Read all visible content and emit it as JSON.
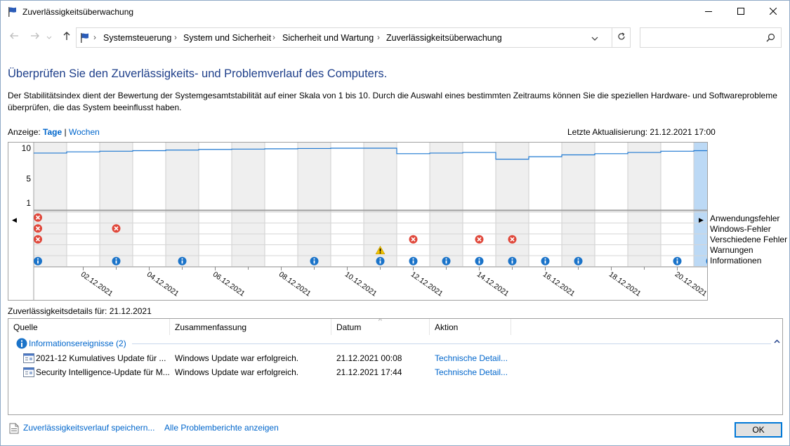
{
  "window": {
    "title": "Zuverlässigkeitsüberwachung"
  },
  "nav": {
    "breadcrumbs": [
      "Systemsteuerung",
      "System und Sicherheit",
      "Sicherheit und Wartung",
      "Zuverlässigkeitsüberwachung"
    ],
    "search_placeholder": ""
  },
  "main": {
    "heading": "Überprüfen Sie den Zuverlässigkeits- und Problemverlauf des Computers.",
    "description": "Der Stabilitätsindex dient der Bewertung der Systemgesamtstabilität auf einer Skala von 1 bis 10. Durch die Auswahl eines bestimmten Zeitraums können Sie die speziellen Hardware- und Softwareprobleme überprüfen, die das System beeinflusst haben.",
    "view_label": "Anzeige:",
    "view_days": "Tage",
    "view_sep": "|",
    "view_weeks": "Wochen",
    "last_update": "Letzte Aktualisierung: 21.12.2021 17:00"
  },
  "chart_data": {
    "type": "line",
    "title": "",
    "ylabel": "",
    "ylim": [
      1,
      10
    ],
    "yticks": [
      10,
      5,
      1
    ],
    "x": [
      "01.12.2021",
      "02.12.2021",
      "03.12.2021",
      "04.12.2021",
      "05.12.2021",
      "06.12.2021",
      "07.12.2021",
      "08.12.2021",
      "09.12.2021",
      "10.12.2021",
      "11.12.2021",
      "12.12.2021",
      "13.12.2021",
      "14.12.2021",
      "15.12.2021",
      "16.12.2021",
      "17.12.2021",
      "18.12.2021",
      "19.12.2021",
      "20.12.2021",
      "21.12.2021"
    ],
    "x_tick_labels": [
      "02.12.2021",
      "04.12.2021",
      "06.12.2021",
      "08.12.2021",
      "10.12.2021",
      "12.12.2021",
      "14.12.2021",
      "16.12.2021",
      "18.12.2021",
      "20.12.2021"
    ],
    "stability_index": [
      9.2,
      9.4,
      9.5,
      9.6,
      9.7,
      9.8,
      9.85,
      9.9,
      9.95,
      10.0,
      10.0,
      9.1,
      9.2,
      9.3,
      8.2,
      8.6,
      8.9,
      9.1,
      9.3,
      9.5,
      9.6
    ],
    "selected_date": "21.12.2021",
    "rows": [
      "Anwendungsfehler",
      "Windows-Fehler",
      "Verschiedene Fehler",
      "Warnungen",
      "Informationen"
    ],
    "events": {
      "Anwendungsfehler": [
        "01.12.2021"
      ],
      "Windows-Fehler": [
        "01.12.2021",
        "03.12.2021"
      ],
      "Verschiedene Fehler": [
        "01.12.2021",
        "12.12.2021",
        "14.12.2021",
        "15.12.2021"
      ],
      "Warnungen": [
        "11.12.2021"
      ],
      "Informationen": [
        "01.12.2021",
        "03.12.2021",
        "05.12.2021",
        "09.12.2021",
        "11.12.2021",
        "12.12.2021",
        "13.12.2021",
        "14.12.2021",
        "15.12.2021",
        "16.12.2021",
        "17.12.2021",
        "20.12.2021",
        "21.12.2021"
      ]
    }
  },
  "details": {
    "label": "Zuverlässigkeitsdetails für: 21.12.2021",
    "columns": [
      "Quelle",
      "Zusammenfassung",
      "Datum",
      "Aktion"
    ],
    "group_label": "Informationsereignisse (2)",
    "rows": [
      {
        "source": "2021-12 Kumulatives Update für ...",
        "summary": "Windows Update war erfolgreich.",
        "date": "21.12.2021 00:08",
        "action": "Technische Detail..."
      },
      {
        "source": "Security Intelligence-Update für M...",
        "summary": "Windows Update war erfolgreich.",
        "date": "21.12.2021 17:44",
        "action": "Technische Detail..."
      }
    ]
  },
  "footer": {
    "save_link": "Zuverlässigkeitsverlauf speichern...",
    "reports_link": "Alle Problemberichte anzeigen",
    "ok": "OK"
  },
  "colors": {
    "accent": "#0078d7",
    "heading": "#1e3f8a",
    "link": "#0066cc",
    "selected_column": "#bcd9f5",
    "error": "#e0473a",
    "warning": "#f2c200",
    "info": "#1a73c9"
  }
}
